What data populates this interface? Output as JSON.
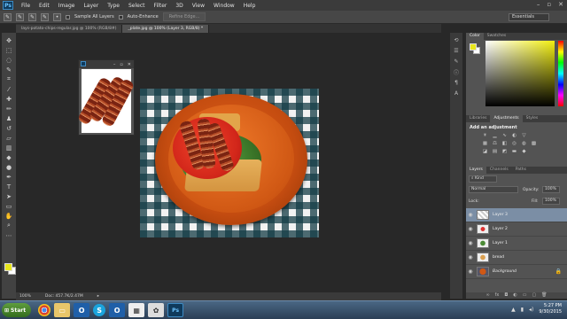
{
  "menubar": {
    "logo": "Ps",
    "items": [
      "File",
      "Edit",
      "Image",
      "Layer",
      "Type",
      "Select",
      "Filter",
      "3D",
      "View",
      "Window",
      "Help"
    ],
    "window_controls": [
      "–",
      "▫",
      "✕"
    ]
  },
  "options": {
    "sample_all_layers": "Sample All Layers",
    "auto_enhance": "Auto-Enhance",
    "refine_edge": "Refine Edge...",
    "workspace": "Essentials"
  },
  "tabs": [
    {
      "label": "lays-potato-chips-regular.jpg @ 100% (RGB/8#)",
      "active": false
    },
    {
      "label": "_plate.jpg @ 100% (Layer 3, RGB/8) *",
      "active": true
    }
  ],
  "status": {
    "zoom": "100%",
    "doc": "Doc: 457.7K/2.47M"
  },
  "panels": {
    "color_tabs": [
      "Color",
      "Swatches"
    ],
    "adjust_tabs": [
      "Libraries",
      "Adjustments",
      "Styles"
    ],
    "adjust_title": "Add an adjustment",
    "layers_tabs": [
      "Layers",
      "Channels",
      "Paths"
    ],
    "filter_kind": "Kind",
    "blend_mode": "Normal",
    "opacity_label": "Opacity:",
    "opacity_value": "100%",
    "lock_label": "Lock:",
    "fill_label": "Fill:",
    "fill_value": "100%"
  },
  "layers": [
    {
      "name": "Layer 3",
      "selected": true
    },
    {
      "name": "Layer 2",
      "selected": false
    },
    {
      "name": "Layer 1",
      "selected": false
    },
    {
      "name": "bread",
      "selected": false
    },
    {
      "name": "Background",
      "selected": false,
      "italic": true
    }
  ],
  "taskbar": {
    "start": "Start",
    "time": "5:27 PM",
    "date": "9/30/2015"
  },
  "colors": {
    "foreground": "#e8e61c",
    "background": "#ffffff",
    "selected_layer": "#7b8ea5",
    "ps_blue": "#3d8bc4"
  }
}
